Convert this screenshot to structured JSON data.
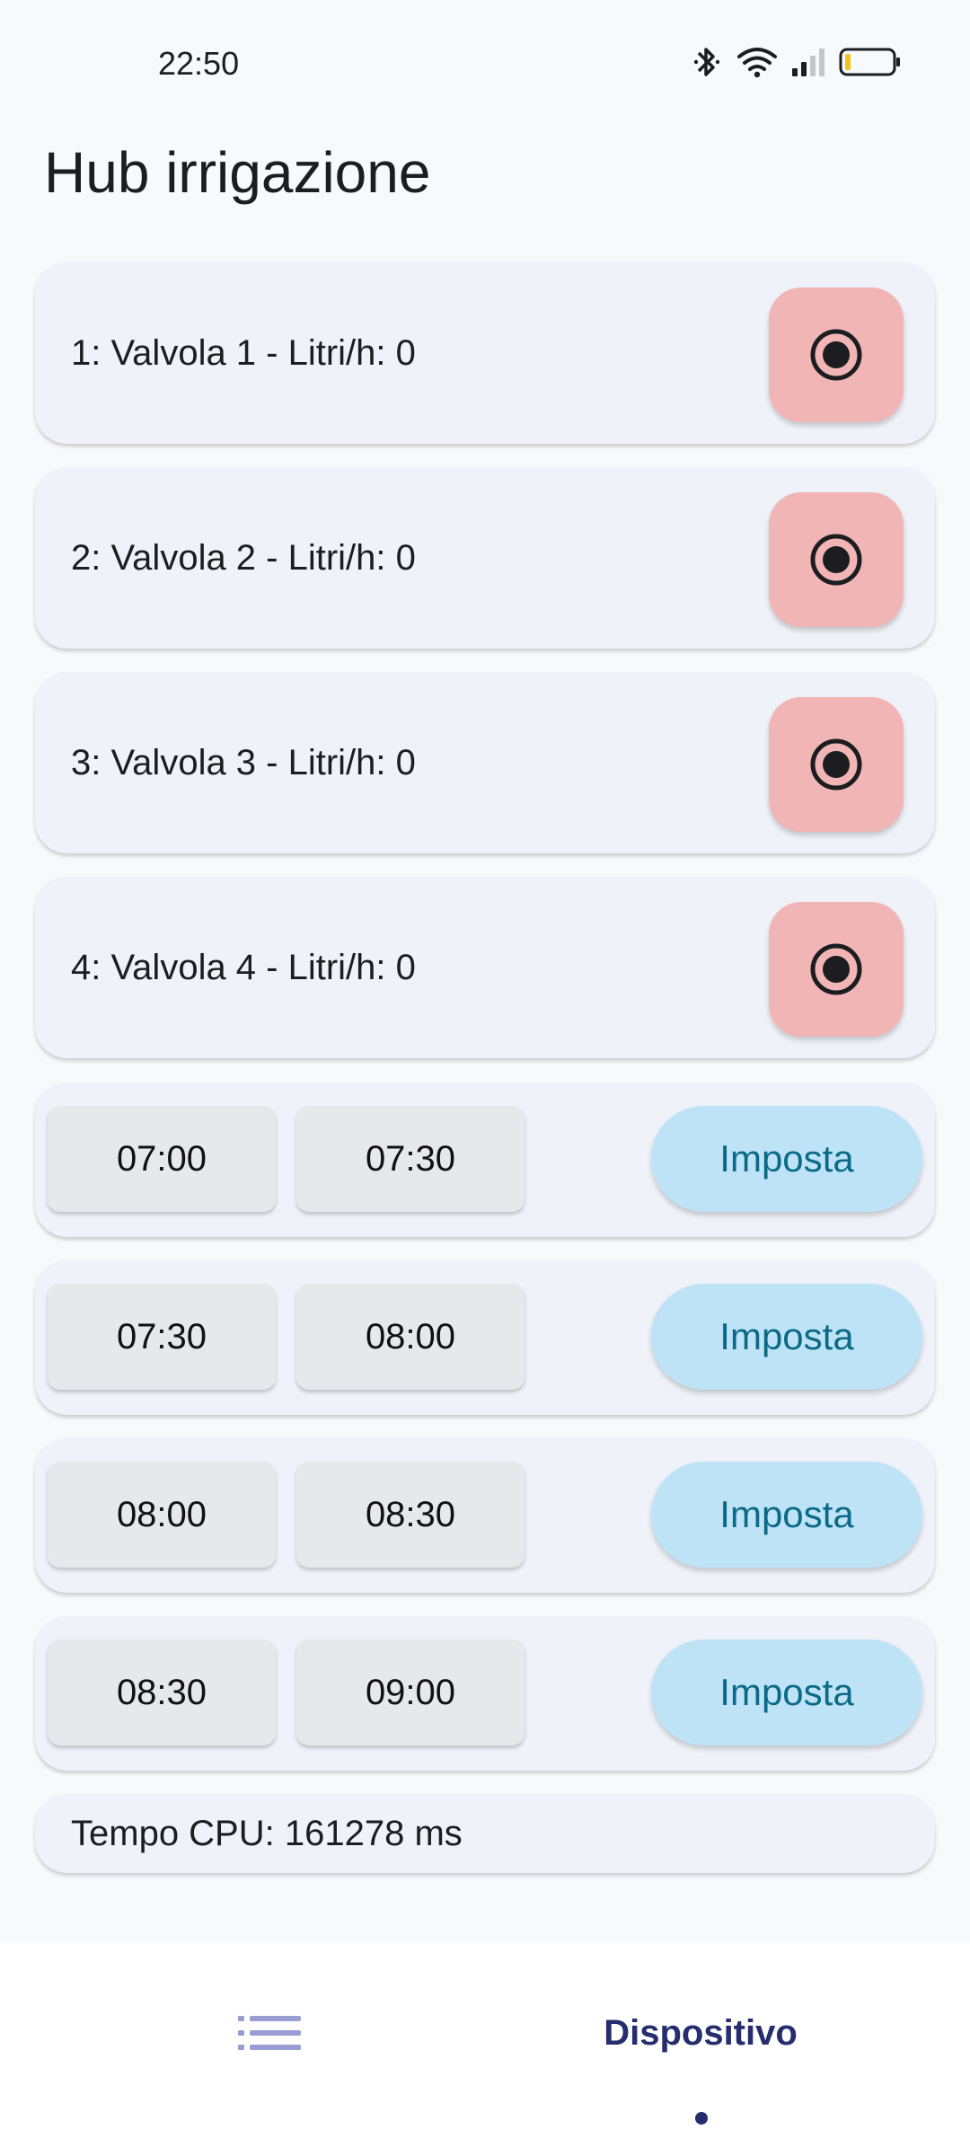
{
  "status_bar": {
    "time": "22:50",
    "icons": [
      "bluetooth-icon",
      "wifi-icon",
      "signal-icon",
      "battery-icon"
    ],
    "battery_level": 0.1
  },
  "page": {
    "title": "Hub irrigazione"
  },
  "valves": [
    {
      "label": "1: Valvola 1 - Litri/h: 0",
      "icon": "radio-button-icon"
    },
    {
      "label": "2: Valvola 2 - Litri/h: 0",
      "icon": "radio-button-icon"
    },
    {
      "label": "3: Valvola 3 - Litri/h: 0",
      "icon": "radio-button-icon"
    },
    {
      "label": "4: Valvola 4 - Litri/h: 0",
      "icon": "radio-button-icon"
    }
  ],
  "schedules": [
    {
      "start": "07:00",
      "end": "07:30",
      "action": "Imposta"
    },
    {
      "start": "07:30",
      "end": "08:00",
      "action": "Imposta"
    },
    {
      "start": "08:00",
      "end": "08:30",
      "action": "Imposta"
    },
    {
      "start": "08:30",
      "end": "09:00",
      "action": "Imposta"
    }
  ],
  "cpu": {
    "text": "Tempo CPU: 161278 ms"
  },
  "bottom_nav": {
    "items": [
      {
        "label": "",
        "icon": "list-icon",
        "selected": false
      },
      {
        "label": "Dispositivo",
        "selected": true
      }
    ]
  },
  "colors": {
    "background": "#f8f9fd",
    "card": "#eff2f8",
    "valve_button": "#f1b5b6",
    "time_button": "#e6e9ec",
    "set_button": "#bee3f7",
    "set_button_text": "#0b6a86",
    "nav_active": "#262d6e",
    "nav_inactive": "#9a9dd3"
  }
}
